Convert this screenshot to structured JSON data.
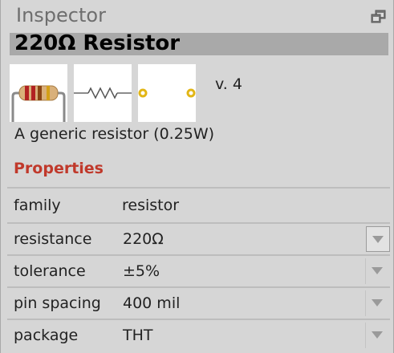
{
  "inspector": {
    "title": "Inspector",
    "float_icon": "float-window-icon"
  },
  "part": {
    "title": "220Ω Resistor",
    "version": "v. 4",
    "description": "A generic resistor (0.25W)",
    "images": [
      {
        "name": "breadboard-view",
        "icon": "resistor-breadboard-icon"
      },
      {
        "name": "schematic-view",
        "icon": "resistor-schematic-icon"
      },
      {
        "name": "pcb-view",
        "icon": "resistor-pcb-icon"
      }
    ]
  },
  "properties": {
    "heading": "Properties",
    "rows": [
      {
        "name": "family",
        "value": "resistor",
        "editable": false
      },
      {
        "name": "resistance",
        "value": "220Ω",
        "editable": true
      },
      {
        "name": "tolerance",
        "value": "±5%",
        "editable": true
      },
      {
        "name": "pin spacing",
        "value": "400 mil",
        "editable": true
      },
      {
        "name": "package",
        "value": "THT",
        "editable": true
      }
    ]
  },
  "colors": {
    "section_heading": "#c0392b",
    "title_band": "#a9a9a9",
    "panel_bg": "#d6d6d6"
  }
}
